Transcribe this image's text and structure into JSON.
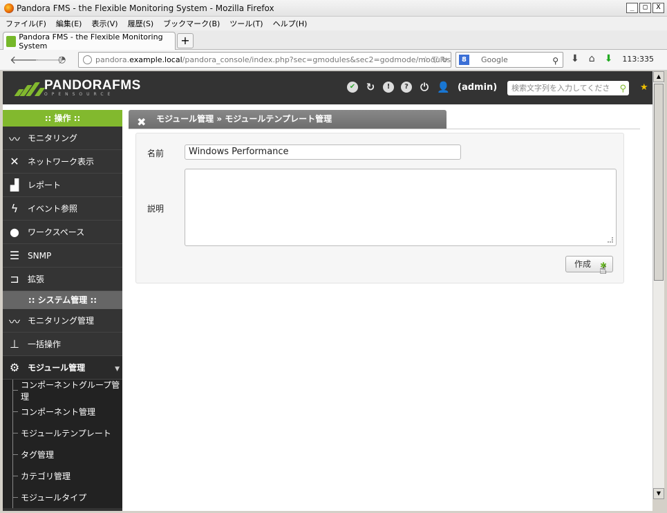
{
  "window": {
    "title": "Pandora FMS - the Flexible Monitoring System - Mozilla Firefox",
    "controls": [
      "_",
      "□",
      "X"
    ]
  },
  "menubar": [
    "ファイル(F)",
    "編集(E)",
    "表示(V)",
    "履歴(S)",
    "ブックマーク(B)",
    "ツール(T)",
    "ヘルプ(H)"
  ],
  "browser_tab": {
    "label": "Pandora FMS - the Flexible Monitoring System",
    "new_tab": "+"
  },
  "urlbar": {
    "prefix": "pandora.",
    "host": "example.local",
    "path": "/pandora_console/index.php?sec=gmodules&sec2=godmode/modules/i"
  },
  "searchbar": {
    "placeholder": "Google",
    "engine_letter": "8"
  },
  "clock": "113:335",
  "header": {
    "logo": "PANDORAFMS",
    "logo_sub": "OPENSOURCE",
    "user": "(admin)",
    "search_placeholder": "検索文字列を入力してくださ",
    "status_icons": [
      "check-icon",
      "refresh-icon",
      "alert-icon",
      "help-icon",
      "power-icon",
      "user-icon"
    ]
  },
  "sidebar": {
    "operation_header": ":: 操作 ::",
    "operation_items": [
      {
        "label": "モニタリング",
        "icon": "heartbeat-icon"
      },
      {
        "label": "ネットワーク表示",
        "icon": "network-icon"
      },
      {
        "label": "レポート",
        "icon": "report-icon"
      },
      {
        "label": "イベント参照",
        "icon": "bolt-icon"
      },
      {
        "label": "ワークスペース",
        "icon": "person-icon"
      },
      {
        "label": "SNMP",
        "icon": "list-icon"
      },
      {
        "label": "拡張",
        "icon": "plugin-icon"
      }
    ],
    "admin_header": ":: システム管理 ::",
    "admin_items": [
      {
        "label": "モニタリング管理",
        "icon": "heartbeat-gear-icon"
      },
      {
        "label": "一括操作",
        "icon": "hierarchy-icon"
      },
      {
        "label": "モジュール管理",
        "icon": "module-gear-icon"
      }
    ],
    "sub_items": [
      "コンポーネントグループ管理",
      "コンポーネント管理",
      "モジュールテンプレート",
      "タグ管理",
      "カテゴリ管理",
      "モジュールタイプ"
    ]
  },
  "main": {
    "breadcrumb": "モジュール管理 » モジュールテンプレート管理",
    "name_label": "名前",
    "name_value": "Windows Performance",
    "desc_label": "説明",
    "desc_value": "",
    "create_button": "作成"
  }
}
